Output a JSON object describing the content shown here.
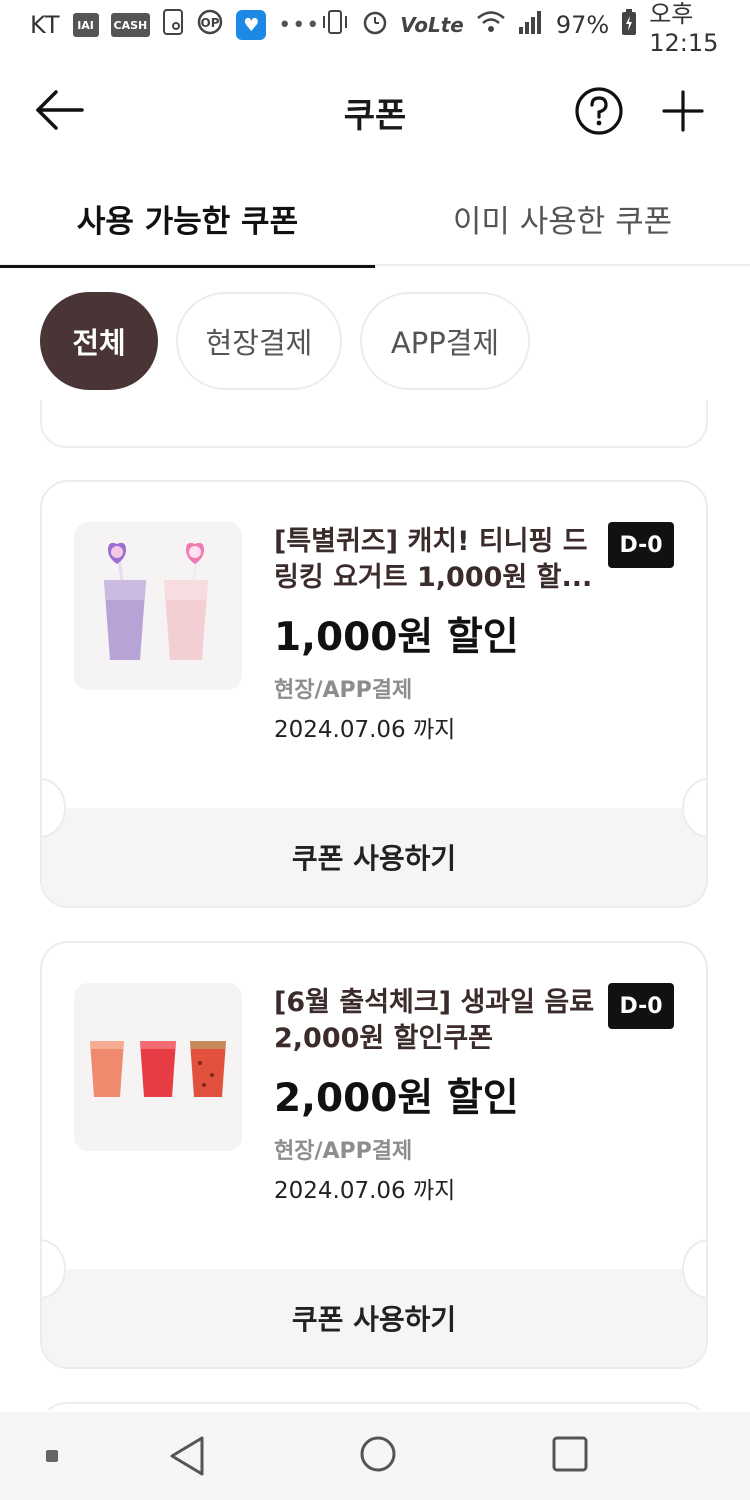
{
  "status_bar": {
    "carrier": "KT",
    "left_icons": [
      "tv-icon",
      "cash-icon",
      "sim-card-icon",
      "op-icon",
      "heart-app-icon",
      "more-notifications-icon"
    ],
    "tv_label": "IAI",
    "cash_label": "CASH",
    "battery": "97%",
    "time": "오후 12:15",
    "volte": "Vo",
    "lte": "Lte"
  },
  "header": {
    "title": "쿠폰"
  },
  "tabs": [
    {
      "label": "사용 가능한 쿠폰",
      "active": true
    },
    {
      "label": "이미 사용한 쿠폰",
      "active": false
    }
  ],
  "filters": [
    {
      "label": "전체",
      "active": true
    },
    {
      "label": "현장결제",
      "active": false
    },
    {
      "label": "APP결제",
      "active": false
    }
  ],
  "coupons": [
    {
      "title": "[특별퀴즈] 캐치! 티니핑 드링킹 요거트 1,000원 할...",
      "amount": "1,000원 할인",
      "payment_type": "현장/APP결제",
      "expiry": "2024.07.06 까지",
      "dday": "D-0",
      "action": "쿠폰 사용하기",
      "image": "yogurt-drinks"
    },
    {
      "title": "[6월 출석체크] 생과일 음료 2,000원 할인쿠폰",
      "amount": "2,000원 할인",
      "payment_type": "현장/APP결제",
      "expiry": "2024.07.06 까지",
      "dday": "D-0",
      "action": "쿠폰 사용하기",
      "image": "fruit-juices"
    }
  ],
  "colors": {
    "active_chip": "#4a3536",
    "dday_badge": "#111111",
    "title_text": "#3b2b2b"
  }
}
